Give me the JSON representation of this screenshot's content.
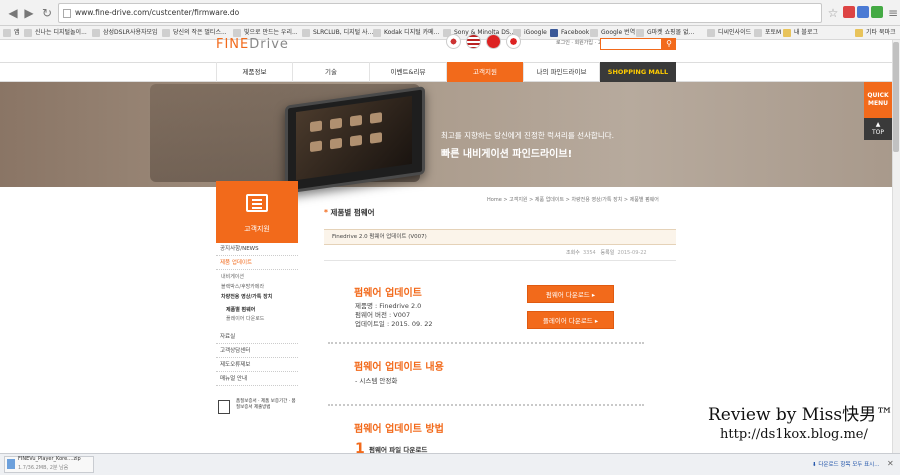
{
  "browser": {
    "url": "www.fine-drive.com/custcenter/firmware.do",
    "bookmarks": [
      {
        "label": "앱"
      },
      {
        "label": "신나는 디지털놀이..."
      },
      {
        "label": "삼성DSLR사용자모임"
      },
      {
        "label": "당신의 작은 멀티스..."
      },
      {
        "label": "빛으로 만드는 우리..."
      },
      {
        "label": "SLRCLUB, 디지털 사..."
      },
      {
        "label": "Kodak 디지털 카메..."
      },
      {
        "label": "Sony & Minolta DS..."
      },
      {
        "label": "iGoogle"
      },
      {
        "label": "Facebook"
      },
      {
        "label": "Google 번역"
      },
      {
        "label": "G마켓 쇼핑몰 없..."
      },
      {
        "label": "디씨인사이드"
      },
      {
        "label": "포토M"
      },
      {
        "label": "내 블로그"
      },
      {
        "label": "기타 북마크"
      }
    ]
  },
  "header": {
    "logo_fine": "FINE",
    "logo_drive": "Drive",
    "top_links": "로그인 · 회원가입 · 고객상담센터",
    "search_icon": "search-icon"
  },
  "gnb": [
    {
      "label": "제품정보"
    },
    {
      "label": "기술"
    },
    {
      "label": "이벤트&리뷰"
    },
    {
      "label": "고객지원"
    },
    {
      "label": "나의 파인드라이브"
    },
    {
      "label": "SHOPPING MALL"
    }
  ],
  "hero": {
    "tagline": "최고를 지향하는 당신에게 진정한 럭셔리를 선사합니다.",
    "title": "빠른 내비게이션 파인드라이브!"
  },
  "quick": {
    "menu": "QUICK MENU",
    "top": "TOP"
  },
  "sidebar": {
    "title": "고객지원",
    "items": [
      {
        "label": "공지사항/NEWS"
      },
      {
        "label": "제품 업데이트"
      },
      {
        "label": "자료실"
      },
      {
        "label": "고객상담센터"
      },
      {
        "label": "제도오류제보"
      },
      {
        "label": "매뉴얼 안내"
      }
    ],
    "subitems": [
      {
        "label": "내비게이션"
      },
      {
        "label": "블랙박스/후방카메라"
      },
      {
        "label": "차량전용 영상/가톡 장치"
      },
      {
        "label": "제품별 펌웨어"
      },
      {
        "label": "플레이어 다운로드"
      }
    ],
    "support_text": "품질보증서 · 제품 보증기간 · 품질보증서 제출방법"
  },
  "content": {
    "breadcrumb": "Home > 고객지원 > 제품 업데이트 > 차량전용 영상/가톡 장치 > 제품별 펌웨어",
    "page_title": "제품별 펌웨어",
    "post_title": "Finedrive 2.0 펌웨어 업데이트 (V007)",
    "views_label": "조회수",
    "views": "3354",
    "date_label": "등록일",
    "date": "2015-09-22",
    "section1_title": "펌웨어 업데이트",
    "product": "제품명 : Finedrive 2.0",
    "version": "펌웨어 버전 : V007",
    "updated": "업데이트일 : 2015. 09. 22",
    "btn_firmware": "펌웨어 다운로드 ▸",
    "btn_player": "플레이어 다운로드 ▸",
    "section2_title": "펌웨어 업데이트 내용",
    "section2_item": "- 시스템 안정화",
    "section3_title": "펌웨어 업데이트 방법",
    "step1_num": "1",
    "step1_text": "펌웨어 파일 다운로드"
  },
  "watermark": {
    "line1": "Review by Miss快男™",
    "line2": "http://ds1kox.blog.me/"
  },
  "downloads": {
    "file": "FINEVu_Player_Kore....zip",
    "status": "1.7/36.2MB, 2분 남음",
    "show_all": "다운로드 항목 모두 표시..."
  },
  "colors": {
    "accent": "#f26a1b",
    "dark": "#3a3a3a"
  }
}
